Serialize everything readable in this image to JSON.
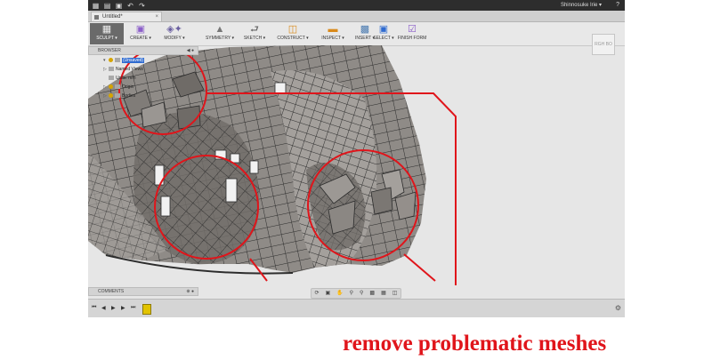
{
  "window": {
    "user_name": "Shinnosuke Irie ▾",
    "help_label": "?",
    "icons": [
      "grid-menu-icon",
      "file-icon",
      "save-icon",
      "undo-icon",
      "redo-icon"
    ]
  },
  "tab": {
    "title": "Untitled*",
    "close": "×"
  },
  "ribbon": {
    "sculpt": "SCULPT ▾",
    "create": "CREATE ▾",
    "modify": "MODIFY ▾",
    "symmetry": "SYMMETRY ▾",
    "sketch": "SKETCH ▾",
    "construct": "CONSTRUCT ▾",
    "inspect": "INSPECT ▾",
    "insert": "INSERT ▾",
    "select": "SELECT ▾",
    "finish": "FINISH FORM"
  },
  "browser": {
    "title": "BROWSER",
    "controls": "◀ ●",
    "items": [
      {
        "label": "(Unsaved)"
      },
      {
        "label": "Named Views"
      },
      {
        "label": "Units: mm"
      },
      {
        "label": "Origin"
      },
      {
        "label": "Bodies"
      }
    ]
  },
  "viewcube": {
    "labels": "RGH  BO"
  },
  "comments": {
    "title": "COMMENTS",
    "controls": "⊕ ●"
  },
  "caption": "remove problematic meshes",
  "colors": {
    "annotation": "#e0151b",
    "selection": "#2f6bd0",
    "mesh_fill": "#8c8884"
  }
}
